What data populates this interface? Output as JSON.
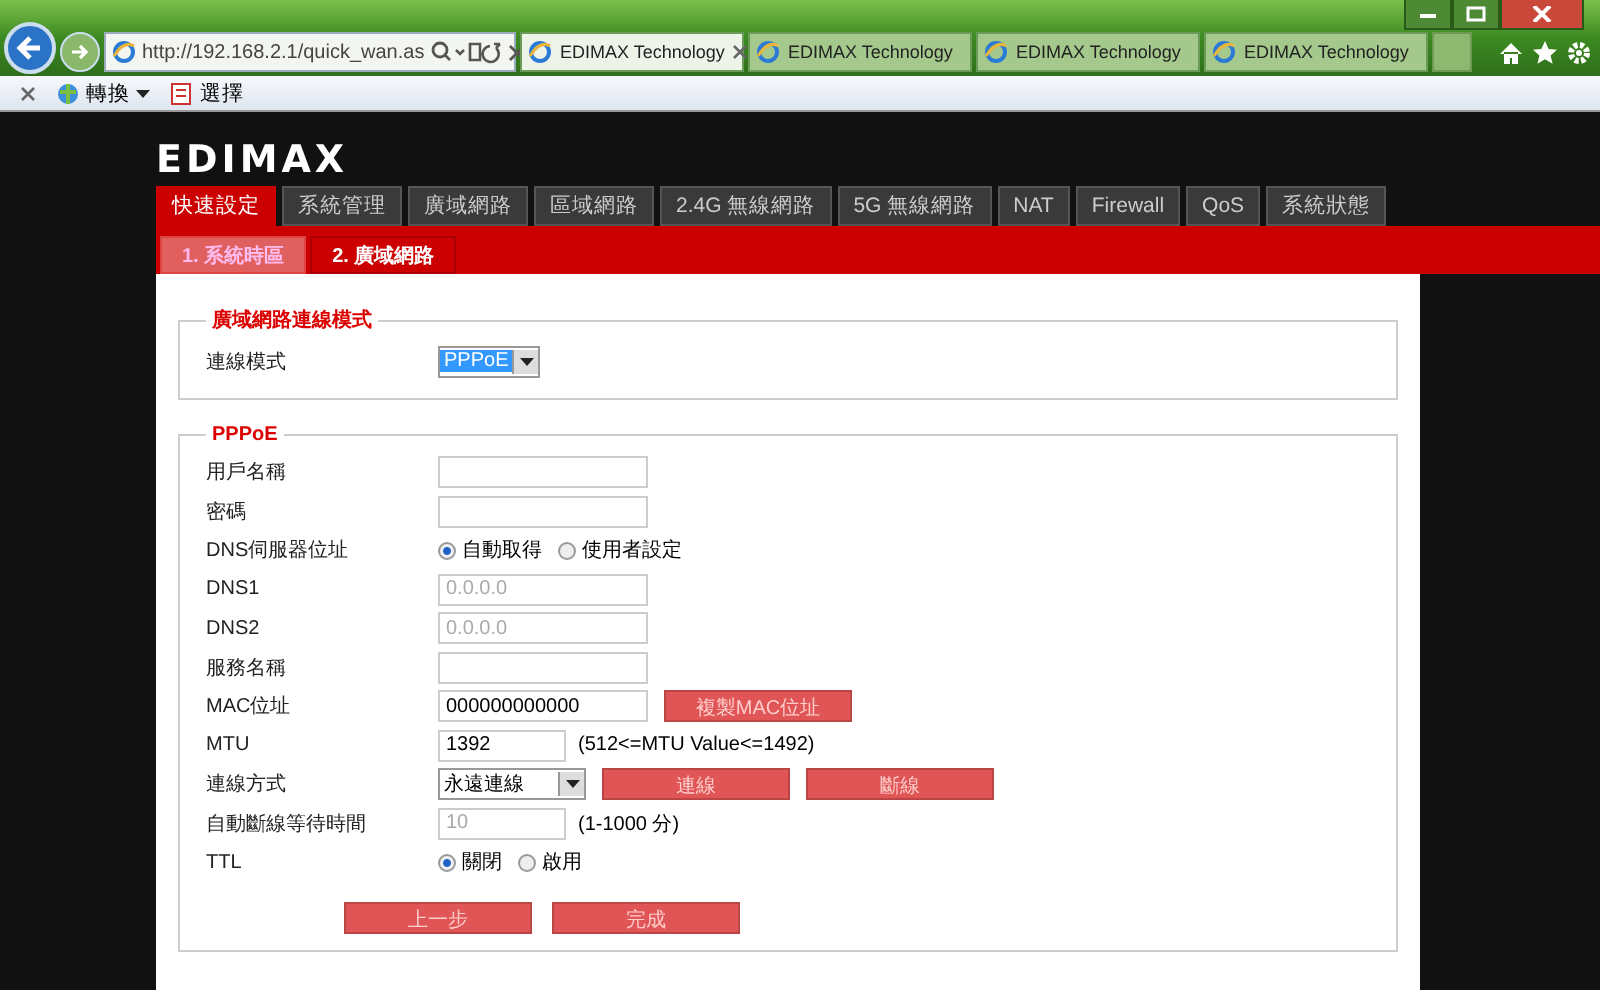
{
  "browser": {
    "address": "http://192.168.2.1/quick_wan.as",
    "tabs": [
      {
        "title": "EDIMAX Technology",
        "selected": true
      },
      {
        "title": "EDIMAX Technology",
        "selected": false
      },
      {
        "title": "EDIMAX Technology",
        "selected": false
      },
      {
        "title": "EDIMAX Technology",
        "selected": false
      }
    ],
    "command_bar": [
      {
        "label": "轉換",
        "dropdown": true
      },
      {
        "label": "選擇",
        "dropdown": false
      }
    ]
  },
  "logo": "EDIMAX",
  "nav_tabs": [
    {
      "label": "快速設定",
      "selected": true
    },
    {
      "label": "系統管理",
      "selected": false
    },
    {
      "label": "廣域網路",
      "selected": false
    },
    {
      "label": "區域網路",
      "selected": false
    },
    {
      "label": "2.4G 無線網路",
      "selected": false
    },
    {
      "label": "5G 無線網路",
      "selected": false
    },
    {
      "label": "NAT",
      "selected": false
    },
    {
      "label": "Firewall",
      "selected": false
    },
    {
      "label": "QoS",
      "selected": false
    },
    {
      "label": "系統狀態",
      "selected": false
    }
  ],
  "sub_tabs": [
    {
      "label": "1. 系統時區",
      "selected": false
    },
    {
      "label": "2. 廣域網路",
      "selected": true
    }
  ],
  "sections": [
    {
      "title": "廣域網路連線模式",
      "rows": [
        {
          "kind": "select",
          "label": "連線模式",
          "value": "PPPoE",
          "highlighted": true
        }
      ]
    },
    {
      "title": "PPPoE",
      "rows": [
        {
          "kind": "text",
          "label": "用戶名稱"
        },
        {
          "kind": "text",
          "label": "密碼"
        },
        {
          "kind": "radio",
          "label": "DNS伺服器位址",
          "options": [
            {
              "label": "自動取得",
              "selected": true
            },
            {
              "label": "使用者設定",
              "selected": false
            }
          ]
        },
        {
          "kind": "text",
          "label": "DNS1",
          "value": "0.0.0.0",
          "disabled": true
        },
        {
          "kind": "text",
          "label": "DNS2",
          "value": "0.0.0.0",
          "disabled": true
        },
        {
          "kind": "text",
          "label": "服務名稱"
        },
        {
          "kind": "text",
          "label": "MAC位址",
          "value": "000000000000",
          "buttons": [
            "複製MAC位址"
          ]
        },
        {
          "kind": "short",
          "label": "MTU",
          "value": "1392",
          "note": "(512<=MTU Value<=1492)"
        },
        {
          "kind": "select",
          "label": "連線方式",
          "value": "永遠連線",
          "highlighted": false,
          "buttons": [
            "連線",
            "斷線"
          ]
        },
        {
          "kind": "short",
          "label": "自動斷線等待時間",
          "value": "10",
          "disabled": true,
          "note": "(1-1000 分)"
        },
        {
          "kind": "radio",
          "label": "TTL",
          "options": [
            {
              "label": "關閉",
              "selected": true
            },
            {
              "label": "啟用",
              "selected": false
            }
          ]
        }
      ],
      "footer_buttons": [
        "上一步",
        "完成"
      ]
    }
  ]
}
